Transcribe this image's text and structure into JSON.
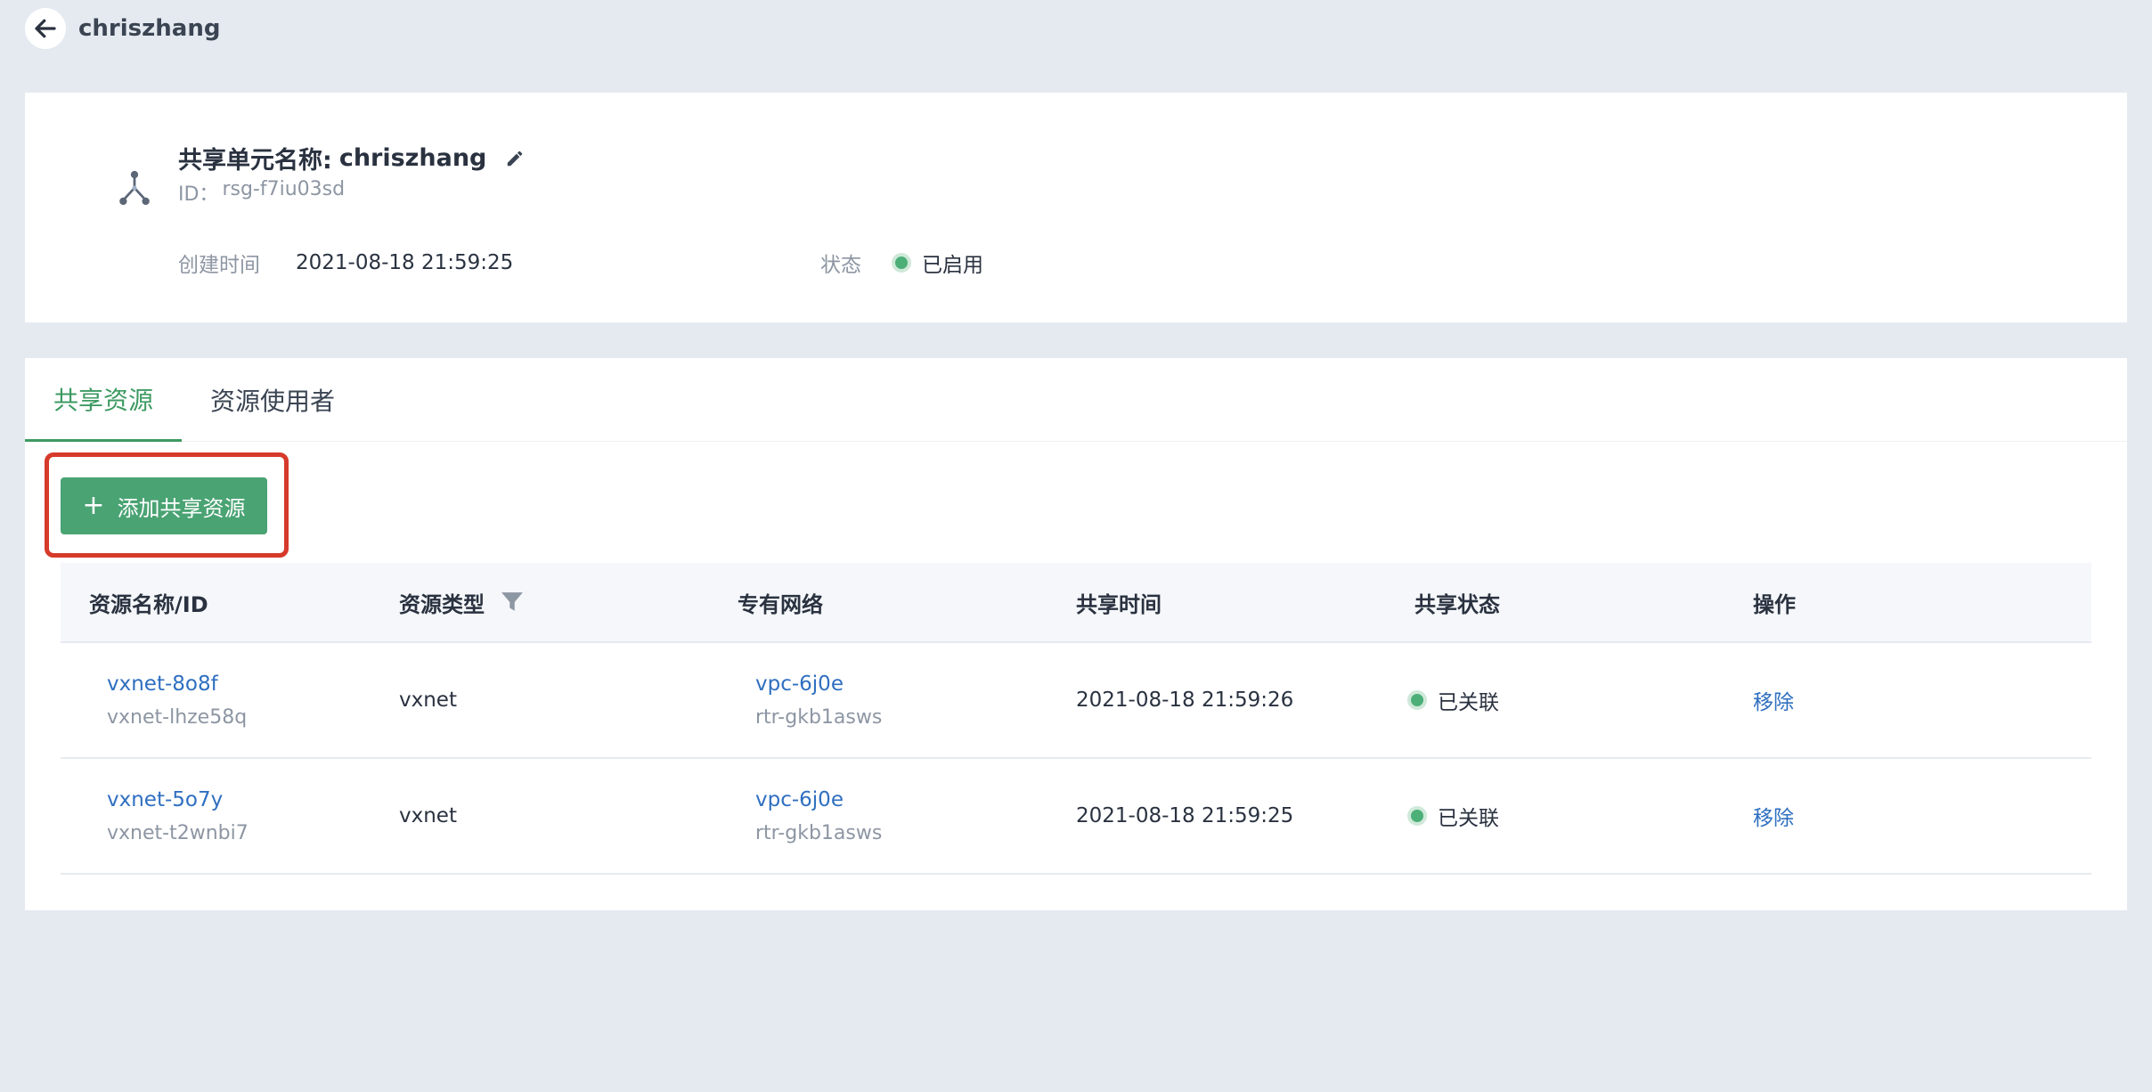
{
  "header": {
    "title": "chriszhang"
  },
  "info": {
    "name_label": "共享单元名称:",
    "name_value": "chriszhang",
    "id_label": "ID：",
    "id_value": "rsg-f7iu03sd",
    "created_label": "创建时间",
    "created_value": "2021-08-18 21:59:25",
    "status_label": "状态",
    "status_value": "已启用"
  },
  "tabs": [
    {
      "label": "共享资源",
      "active": true
    },
    {
      "label": "资源使用者",
      "active": false
    }
  ],
  "add_button": {
    "label": "添加共享资源"
  },
  "table": {
    "headers": [
      "资源名称/ID",
      "资源类型",
      "专有网络",
      "共享时间",
      "共享状态",
      "操作"
    ],
    "rows": [
      {
        "name": "vxnet-8o8f",
        "id": "vxnet-lhze58q",
        "type": "vxnet",
        "vpc": "vpc-6j0e",
        "router": "rtr-gkb1asws",
        "time": "2021-08-18 21:59:26",
        "status": "已关联",
        "action": "移除"
      },
      {
        "name": "vxnet-5o7y",
        "id": "vxnet-t2wnbi7",
        "type": "vxnet",
        "vpc": "vpc-6j0e",
        "router": "rtr-gkb1asws",
        "time": "2021-08-18 21:59:25",
        "status": "已关联",
        "action": "移除"
      }
    ]
  },
  "colors": {
    "accent": "#4aa373",
    "link": "#2f6fc0",
    "status_green": "#4caf78",
    "highlight": "#d63a2a"
  }
}
